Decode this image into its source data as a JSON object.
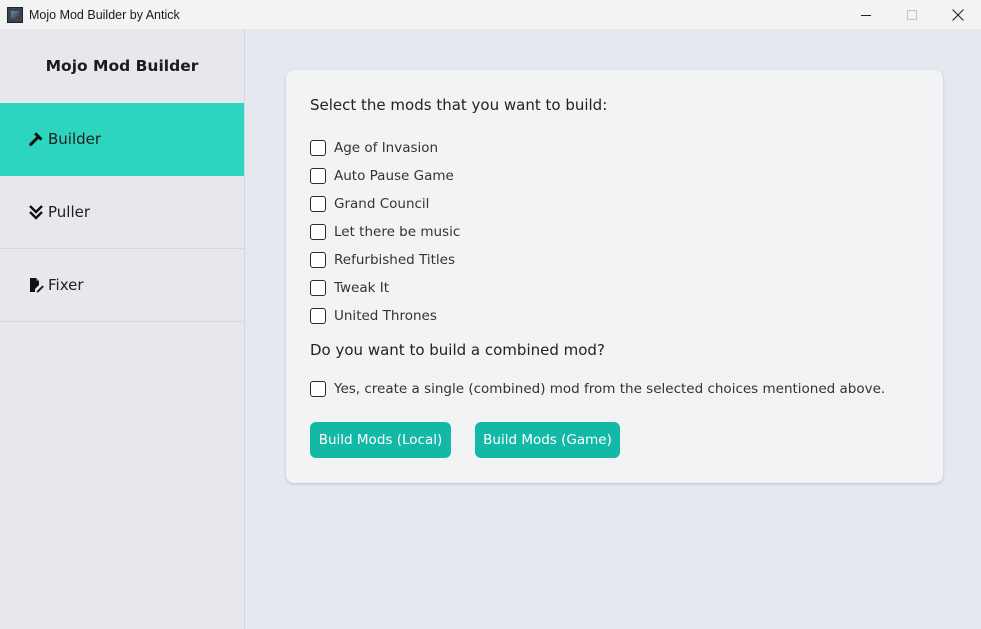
{
  "window": {
    "title": "Mojo Mod Builder by Antick",
    "icon": "app-icon",
    "controls": [
      "minimize",
      "restore",
      "close"
    ]
  },
  "sidebar": {
    "title": "Mojo Mod Builder",
    "items": [
      {
        "label": "Builder",
        "icon": "hammer-icon",
        "active": true
      },
      {
        "label": "Puller",
        "icon": "double-chevron-down-icon",
        "active": false
      },
      {
        "label": "Fixer",
        "icon": "file-edit-icon",
        "active": false
      }
    ]
  },
  "main": {
    "select_prompt": "Select the mods that you want to build:",
    "mods": [
      {
        "label": "Age of Invasion",
        "checked": false
      },
      {
        "label": "Auto Pause Game",
        "checked": false
      },
      {
        "label": "Grand Council",
        "checked": false
      },
      {
        "label": "Let there be music",
        "checked": false
      },
      {
        "label": "Refurbished Titles",
        "checked": false
      },
      {
        "label": "Tweak It",
        "checked": false
      },
      {
        "label": "United Thrones",
        "checked": false
      }
    ],
    "combined_prompt": "Do you want to build a combined mod?",
    "combined_option": {
      "label": "Yes, create a single (combined) mod from the selected choices mentioned above.",
      "checked": false
    },
    "buttons": {
      "local": "Build Mods (Local)",
      "game": "Build Mods (Game)"
    }
  },
  "colors": {
    "accent": "#2dd4bf",
    "button": "#14b8a6",
    "background": "#e6e8ef",
    "sidebar": "#e8e8ec",
    "card": "#f2f3f5"
  }
}
